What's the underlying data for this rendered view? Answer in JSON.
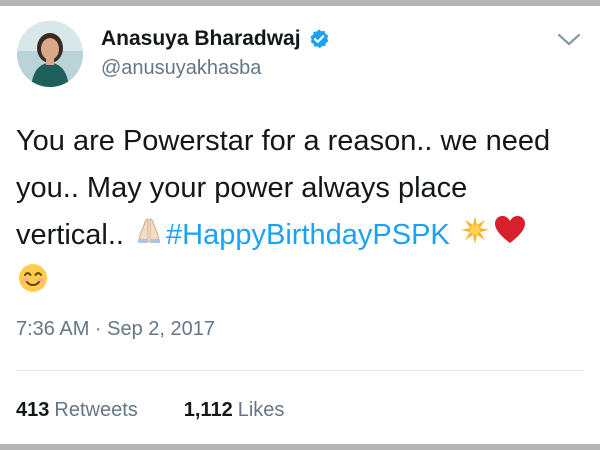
{
  "tweet": {
    "author": {
      "display_name": "Anasuya Bharadwaj",
      "handle": "@anusuyakhasba",
      "verified": true
    },
    "text_line1": "You are Powerstar for a reason.. we need",
    "text_line2": "you.. May your power always place",
    "text_line3": "vertical..",
    "hashtag": "#HappyBirthdayPSPK",
    "emojis": [
      "folded-hands-icon",
      "glowing-star-icon",
      "red-heart-icon",
      "smiling-face-icon"
    ],
    "timestamp": "7:36 AM · Sep 2, 2017",
    "stats": {
      "retweets_count": "413",
      "retweets_label": "Retweets",
      "likes_count": "1,112",
      "likes_label": "Likes"
    }
  },
  "colors": {
    "link": "#1da1f2",
    "secondary_text": "#657786",
    "primary_text": "#14171a",
    "divider": "#e1e8ed",
    "frame_band": "#b5b5b5"
  }
}
